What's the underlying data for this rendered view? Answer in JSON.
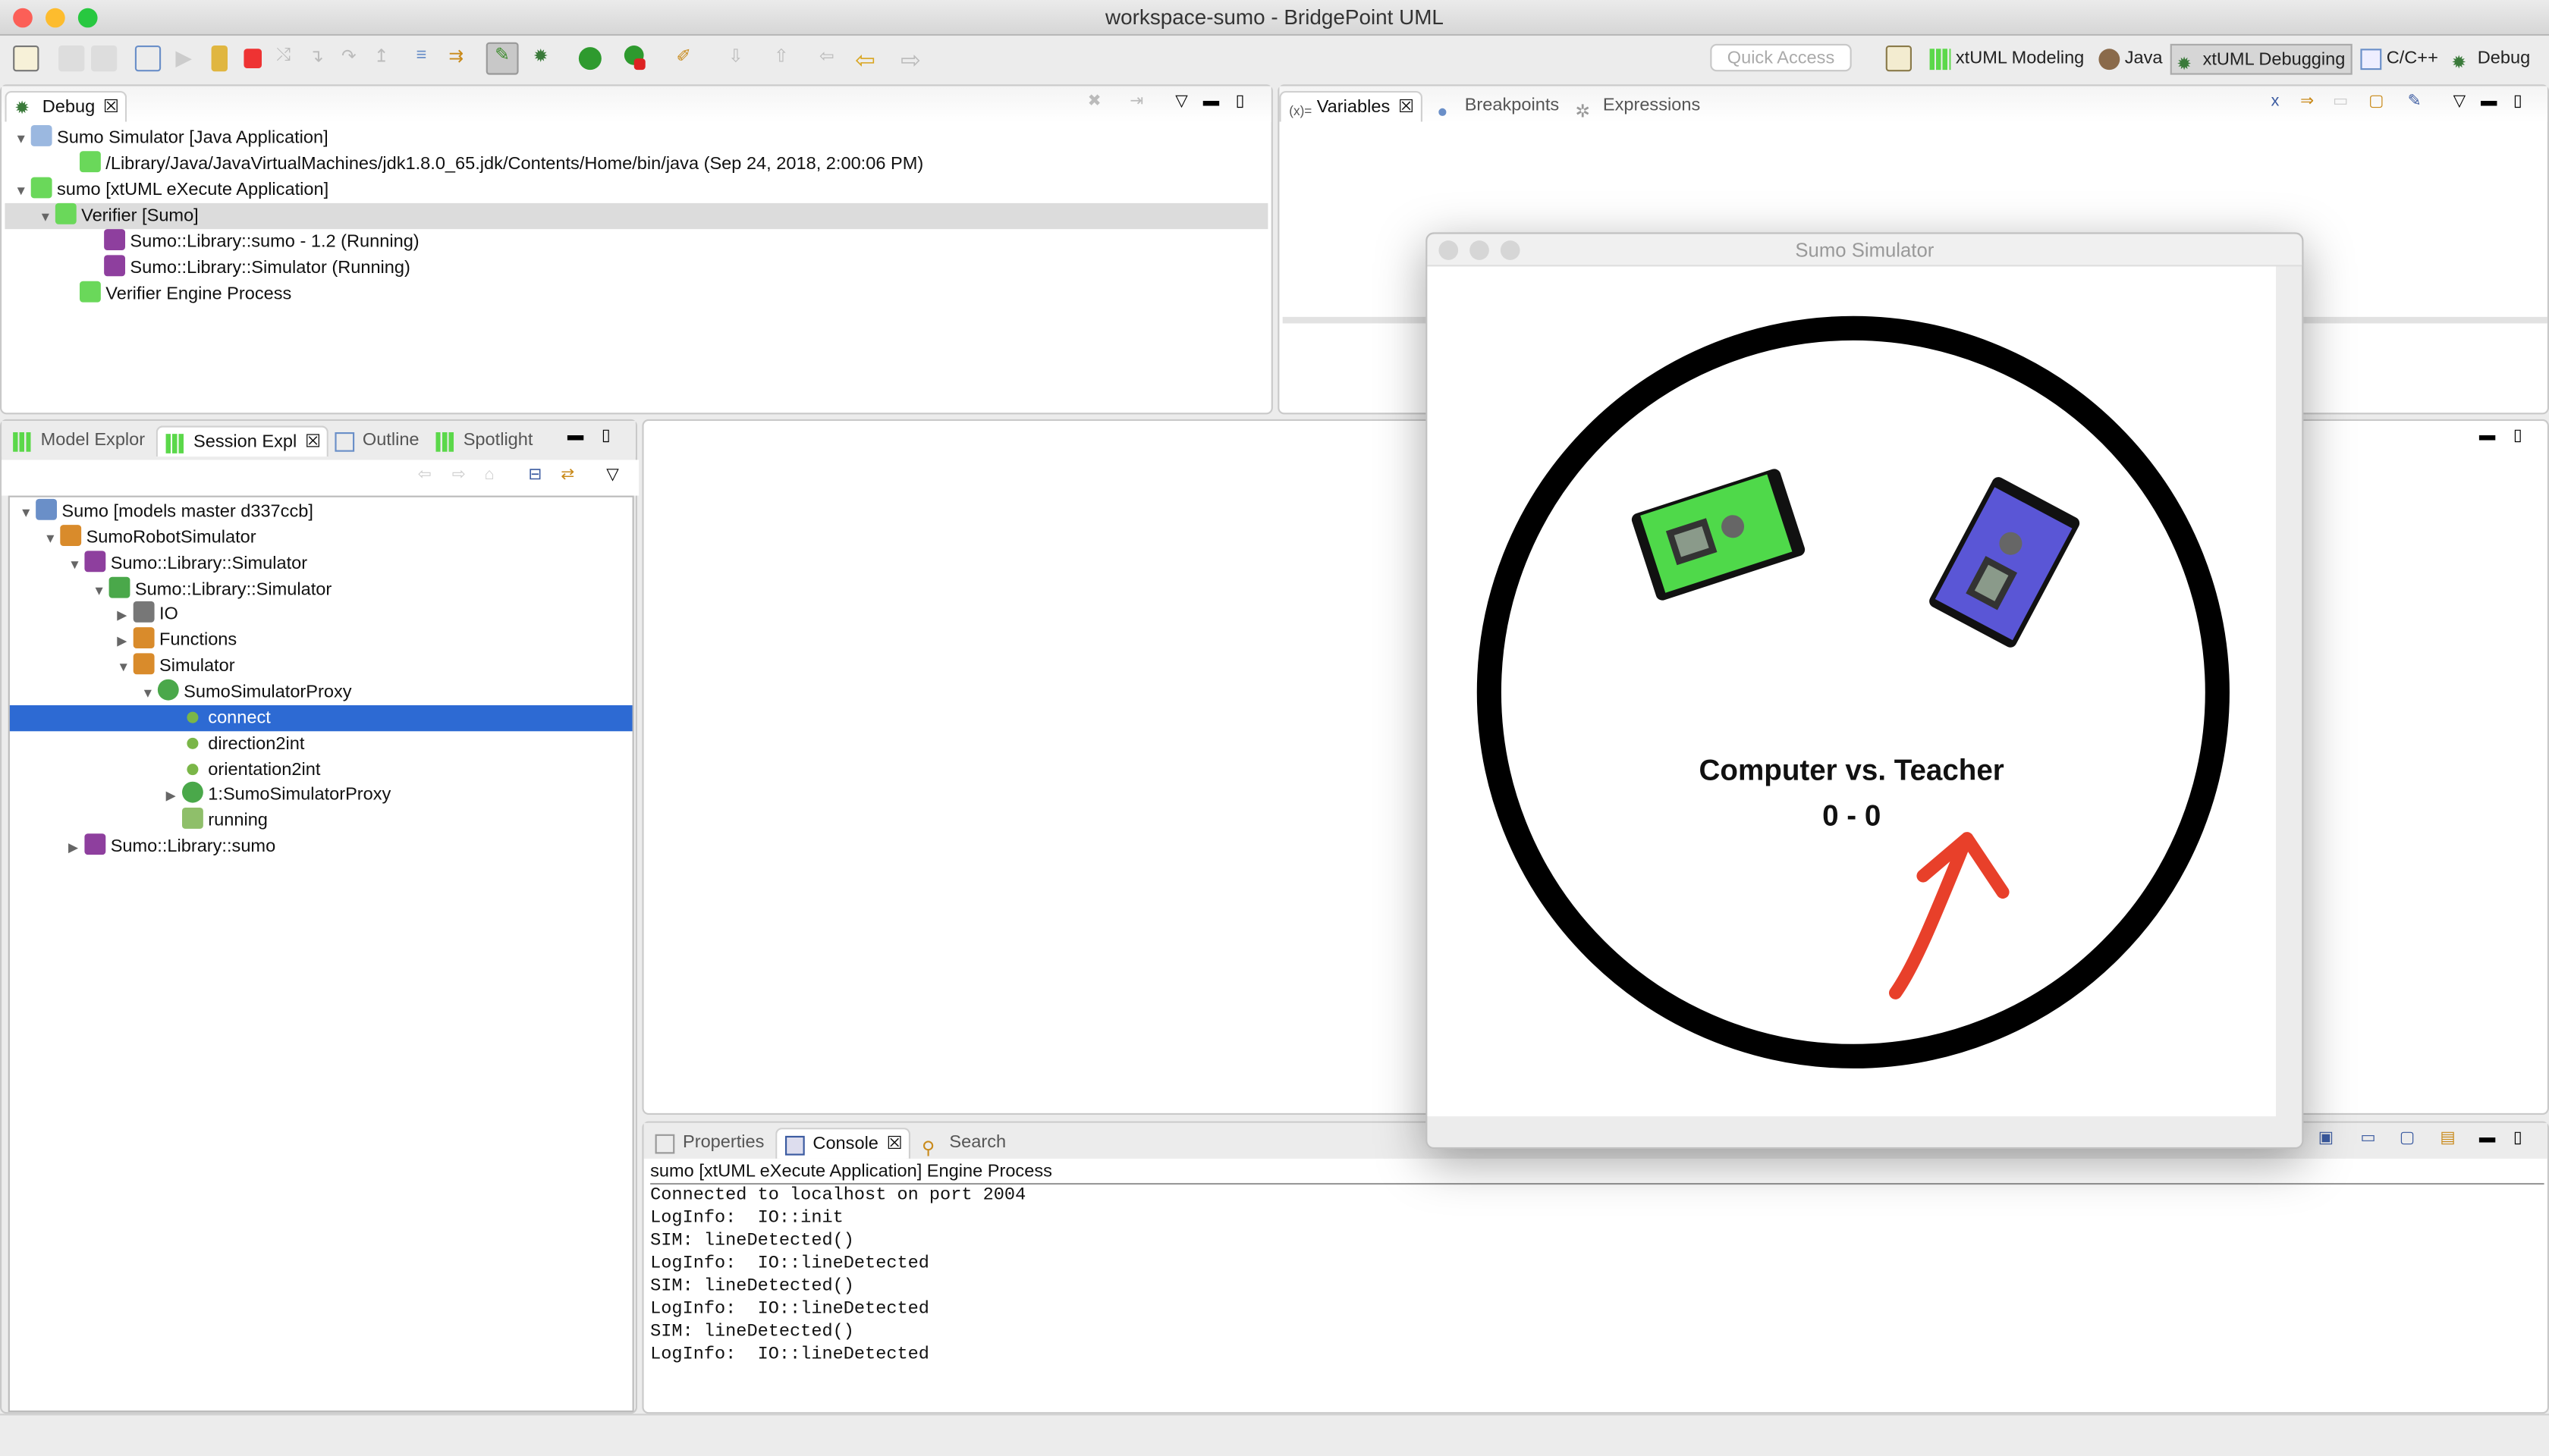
{
  "window": {
    "title": "workspace-sumo - BridgePoint UML"
  },
  "toolbar": {
    "quick_access_placeholder": "Quick Access",
    "perspectives": [
      {
        "label": "xtUML Modeling",
        "active": false
      },
      {
        "label": "Java",
        "active": false
      },
      {
        "label": "xtUML Debugging",
        "active": true
      },
      {
        "label": "C/C++",
        "active": false
      },
      {
        "label": "Debug",
        "active": false
      }
    ]
  },
  "debug_view": {
    "tab": "Debug",
    "rows": [
      {
        "label": "Sumo Simulator [Java Application]",
        "indent": 0,
        "expanded": true,
        "icon": "java-app-icon"
      },
      {
        "label": "/Library/Java/JavaVirtualMachines/jdk1.8.0_65.jdk/Contents/Home/bin/java (Sep 24, 2018, 2:00:06 PM)",
        "indent": 2,
        "icon": "process-icon"
      },
      {
        "label": "sumo [xtUML eXecute Application]",
        "indent": 0,
        "expanded": true,
        "icon": "xtuml-app-icon"
      },
      {
        "label": "Verifier [Sumo]",
        "indent": 1,
        "expanded": true,
        "selected": true,
        "icon": "verifier-icon"
      },
      {
        "label": "Sumo::Library::sumo - 1.2 (Running)",
        "indent": 3,
        "icon": "component-instance-icon"
      },
      {
        "label": "Sumo::Library::Simulator (Running)",
        "indent": 3,
        "icon": "component-instance-icon"
      },
      {
        "label": "Verifier Engine Process",
        "indent": 2,
        "icon": "engine-process-icon"
      }
    ]
  },
  "variables_view": {
    "tabs": [
      "Variables",
      "Breakpoints",
      "Expressions"
    ],
    "active": "Variables"
  },
  "explorer": {
    "tabs": [
      "Model Explor",
      "Session Expl",
      "Outline",
      "Spotlight"
    ],
    "active": "Session Expl",
    "rows": [
      {
        "label": "Sumo [models master d337ccb]",
        "indent": 0,
        "tri": "open",
        "icon": "project-icon",
        "color": "#6a8fc8"
      },
      {
        "label": "SumoRobotSimulator",
        "indent": 1,
        "tri": "open",
        "icon": "package-icon",
        "color": "#d98b2b"
      },
      {
        "label": "Sumo::Library::Simulator",
        "indent": 2,
        "tri": "open",
        "icon": "component-icon",
        "color": "#8e3f9e"
      },
      {
        "label": "Sumo::Library::Simulator",
        "indent": 3,
        "tri": "open",
        "icon": "component-ref-icon",
        "color": "#4aa84a"
      },
      {
        "label": "IO",
        "indent": 4,
        "tri": "closed",
        "icon": "interface-icon",
        "color": "#777777"
      },
      {
        "label": "Functions",
        "indent": 4,
        "tri": "closed",
        "icon": "package-icon",
        "color": "#d98b2b"
      },
      {
        "label": "Simulator",
        "indent": 4,
        "tri": "open",
        "icon": "package-icon",
        "color": "#d98b2b"
      },
      {
        "label": "SumoSimulatorProxy",
        "indent": 5,
        "tri": "open",
        "icon": "class-icon",
        "color": "#4aa84a"
      },
      {
        "label": "connect",
        "indent": 6,
        "tri": "",
        "icon": "operation-icon",
        "color": "#7ab648",
        "selected": true
      },
      {
        "label": "direction2int",
        "indent": 6,
        "tri": "",
        "icon": "operation-icon",
        "color": "#7ab648"
      },
      {
        "label": "orientation2int",
        "indent": 6,
        "tri": "",
        "icon": "operation-icon",
        "color": "#7ab648"
      },
      {
        "label": "1:SumoSimulatorProxy",
        "indent": 6,
        "tri": "closed",
        "icon": "instance-icon",
        "color": "#4aa84a"
      },
      {
        "label": "running",
        "indent": 6,
        "tri": "",
        "icon": "attribute-icon",
        "color": "#8fbf6a"
      },
      {
        "label": "Sumo::Library::sumo",
        "indent": 2,
        "tri": "closed",
        "icon": "component-icon",
        "color": "#8e3f9e"
      }
    ]
  },
  "console_view": {
    "tabs": [
      "Properties",
      "Console",
      "Search"
    ],
    "active": "Console",
    "process": "sumo [xtUML eXecute Application] Engine Process",
    "lines": [
      "Connected to localhost on port 2004",
      "LogInfo:  IO::init",
      "SIM: lineDetected()",
      "LogInfo:  IO::lineDetected",
      "SIM: lineDetected()",
      "LogInfo:  IO::lineDetected",
      "SIM: lineDetected()",
      "LogInfo:  IO::lineDetected"
    ]
  },
  "simulator": {
    "title": "Sumo Simulator",
    "match": "Computer vs. Teacher",
    "score": "0 - 0",
    "robot_colors": {
      "computer": "#4fd94a",
      "teacher": "#5a56d6"
    },
    "arrow_color": "#e8402a"
  }
}
